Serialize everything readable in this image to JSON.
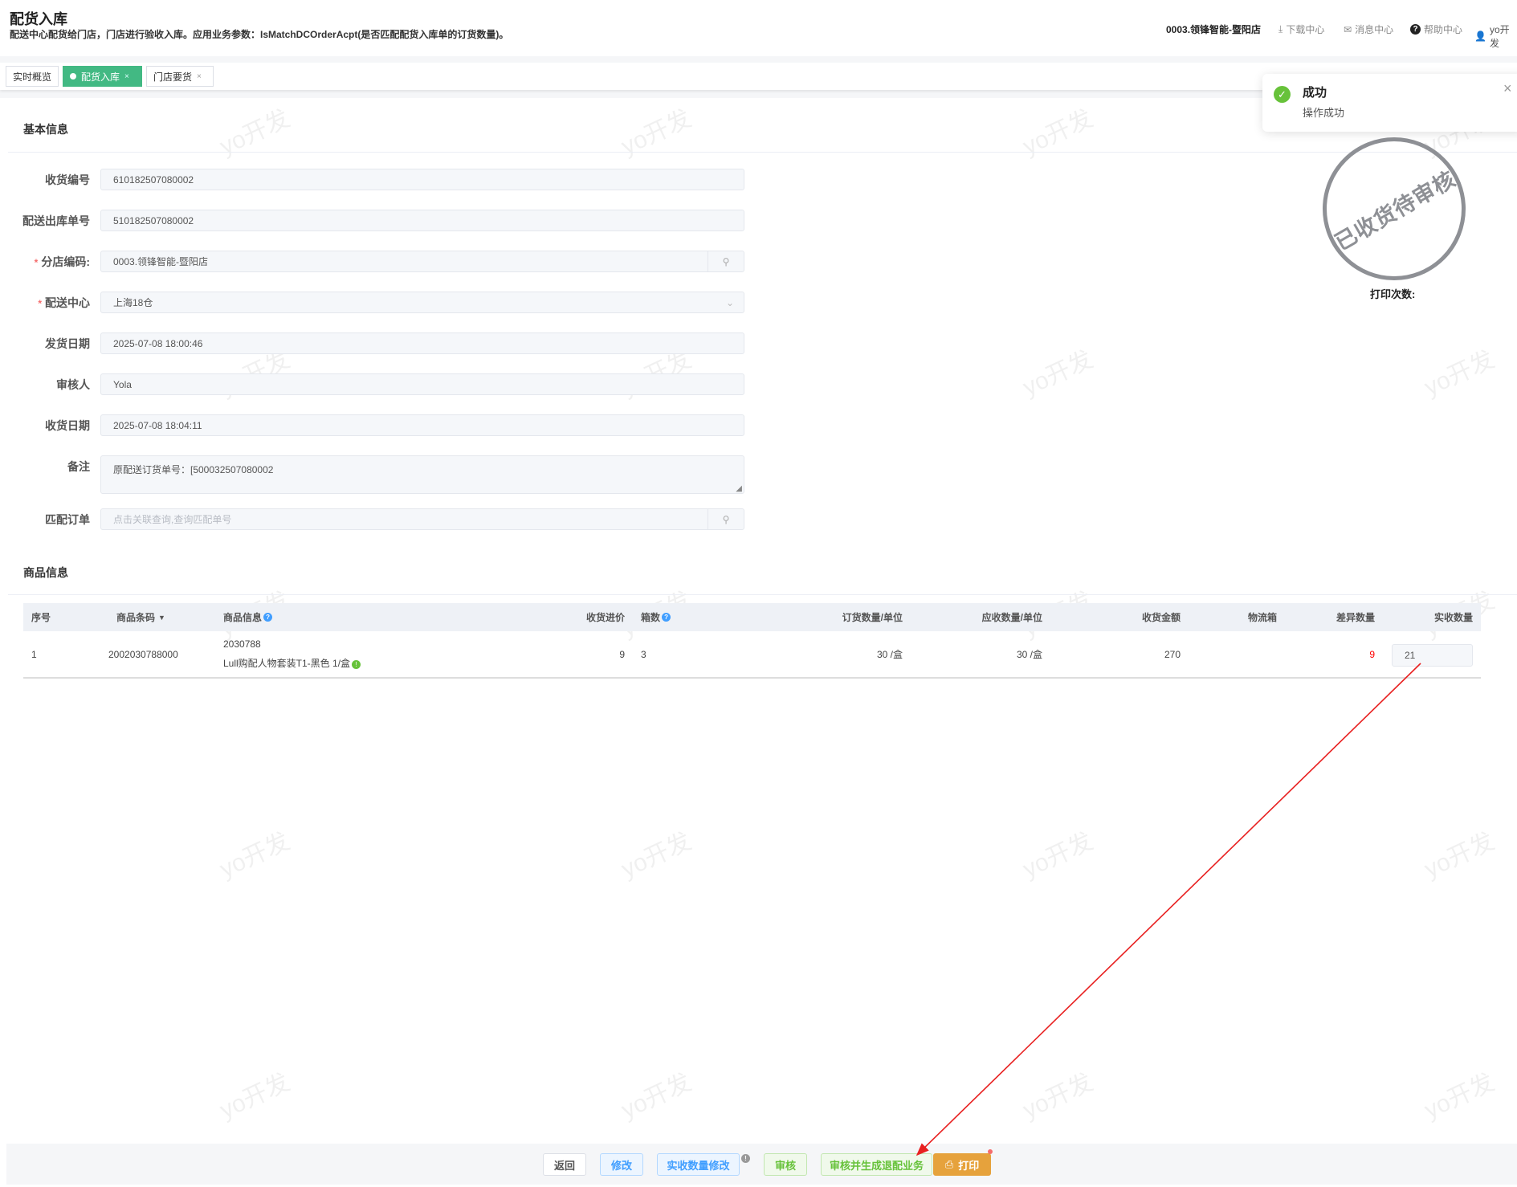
{
  "header": {
    "title": "配货入库",
    "subtitle": "配送中心配货给门店，门店进行验收入库。应用业务参数：IsMatchDCOrderAcpt(是否匹配配货入库单的订货数量)。",
    "store": "0003.领锋智能-暨阳店",
    "download": "下载中心",
    "messages": "消息中心",
    "help": "帮助中心",
    "user": "yo开发"
  },
  "tabs": [
    {
      "label": "实时概览"
    },
    {
      "label": "配货入库",
      "close": "×"
    },
    {
      "label": "门店要货",
      "close": "×"
    }
  ],
  "toast": {
    "title": "成功",
    "message": "操作成功"
  },
  "stamp": {
    "text": "已收货待审核",
    "print_count_label": "打印次数:"
  },
  "watermark": "yo开发",
  "basic": {
    "title": "基本信息",
    "fields": [
      {
        "label": "收货编号",
        "value": "610182507080002"
      },
      {
        "label": "配送出库单号",
        "value": "510182507080002"
      },
      {
        "label": "分店编码:",
        "value": "0003.领锋智能-暨阳店"
      },
      {
        "label": "配送中心",
        "value": "上海18仓"
      },
      {
        "label": "发货日期",
        "value": "2025-07-08 18:00:46"
      },
      {
        "label": "审核人",
        "value": "Yola"
      },
      {
        "label": "收货日期",
        "value": "2025-07-08 18:04:11"
      },
      {
        "label": "备注",
        "value": "原配送订货单号：[500032507080002"
      },
      {
        "label": "匹配订单",
        "placeholder": "点击关联查询,查询匹配单号"
      }
    ]
  },
  "goods": {
    "title": "商品信息",
    "columns": [
      "序号",
      "商品条码",
      "商品信息",
      "收货进价",
      "箱数",
      "订货数量/单位",
      "应收数量/单位",
      "收货金额",
      "物流箱",
      "差异数量",
      "实收数量"
    ],
    "rows": [
      {
        "index": "1",
        "barcode": "2002030788000",
        "code": "2030788",
        "name": "Lull购配人物套装T1-黑色 1/盒",
        "price": "9",
        "boxes": "3",
        "order_qty": "30 /盒",
        "due_qty": "30 /盒",
        "amount": "270",
        "logistics_box": "",
        "diff": "9",
        "received": "21"
      }
    ]
  },
  "footer": {
    "back": "返回",
    "edit": "修改",
    "qty_edit": "实收数量修改",
    "approve": "审核",
    "approve_return": "审核并生成退配业务",
    "print": "打印"
  },
  "colors": {
    "accent": "#42b983",
    "diff": "#ff0000",
    "print": "#e6a23c"
  }
}
